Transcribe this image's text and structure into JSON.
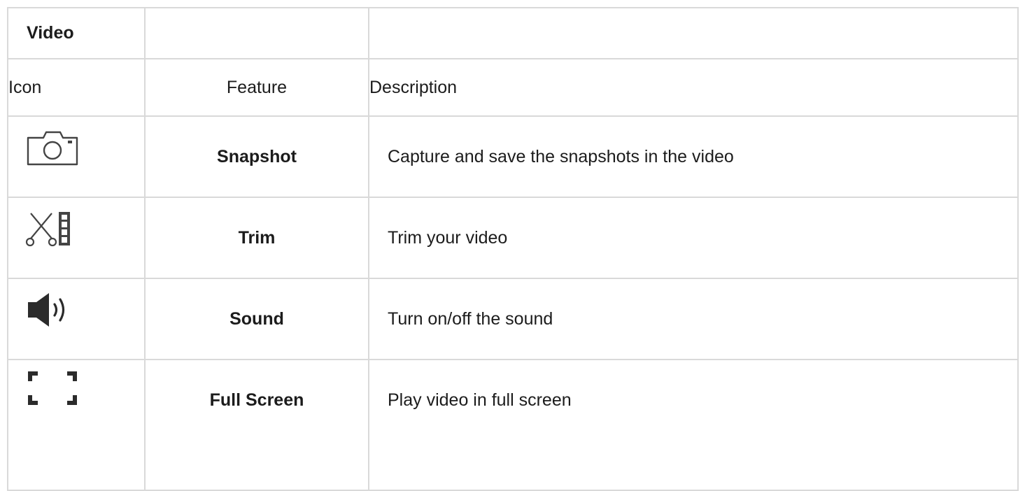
{
  "table": {
    "title": "Video",
    "headers": {
      "icon": "Icon",
      "feature": "Feature",
      "description": "Description"
    },
    "rows": [
      {
        "icon": "camera-icon",
        "feature": "Snapshot",
        "description": "Capture and save the snapshots in the video"
      },
      {
        "icon": "scissors-filmstrip-icon",
        "feature": "Trim",
        "description": "Trim your video"
      },
      {
        "icon": "speaker-icon",
        "feature": "Sound",
        "description": "Turn on/off the sound"
      },
      {
        "icon": "fullscreen-icon",
        "feature": "Full Screen",
        "description": "Play video in full screen"
      }
    ]
  },
  "colors": {
    "border": "#d9d9d9",
    "icon_stroke": "#444444",
    "text": "#1c1c1c"
  }
}
